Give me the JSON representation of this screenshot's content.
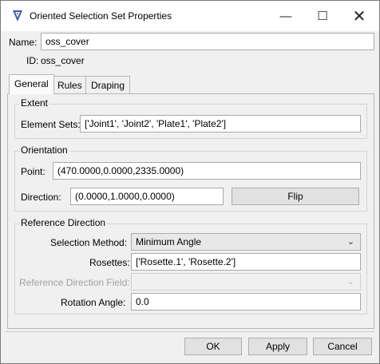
{
  "window": {
    "title": "Oriented Selection Set Properties",
    "icon": "app-logo-icon",
    "controls": {
      "minimize": "—",
      "maximize": "☐",
      "close": "✕"
    }
  },
  "header": {
    "name_label": "Name:",
    "name_value": "oss_cover",
    "id_label": "ID:",
    "id_value": "oss_cover"
  },
  "tabs": [
    {
      "label": "General",
      "active": true
    },
    {
      "label": "Rules",
      "active": false
    },
    {
      "label": "Draping",
      "active": false
    }
  ],
  "extent": {
    "title": "Extent",
    "element_sets_label": "Element Sets:",
    "element_sets_value": "['Joint1', 'Joint2', 'Plate1', 'Plate2']"
  },
  "orientation": {
    "title": "Orientation",
    "point_label": "Point:",
    "point_value": "(470.0000,0.0000,2335.0000)",
    "direction_label": "Direction:",
    "direction_value": "(0.0000,1.0000,0.0000)",
    "flip_label": "Flip"
  },
  "reference": {
    "title": "Reference Direction",
    "selection_method_label": "Selection Method:",
    "selection_method_value": "Minimum Angle",
    "rosettes_label": "Rosettes:",
    "rosettes_value": "['Rosette.1', 'Rosette.2']",
    "ref_field_label": "Reference Direction Field:",
    "ref_field_value": "",
    "rotation_label": "Rotation Angle:",
    "rotation_value": "0.0"
  },
  "footer": {
    "ok": "OK",
    "apply": "Apply",
    "cancel": "Cancel"
  },
  "colors": {
    "logo_blue": "#3a58b8",
    "logo_red": "#d23a2a",
    "disabled_text": "#a0a0a0"
  }
}
